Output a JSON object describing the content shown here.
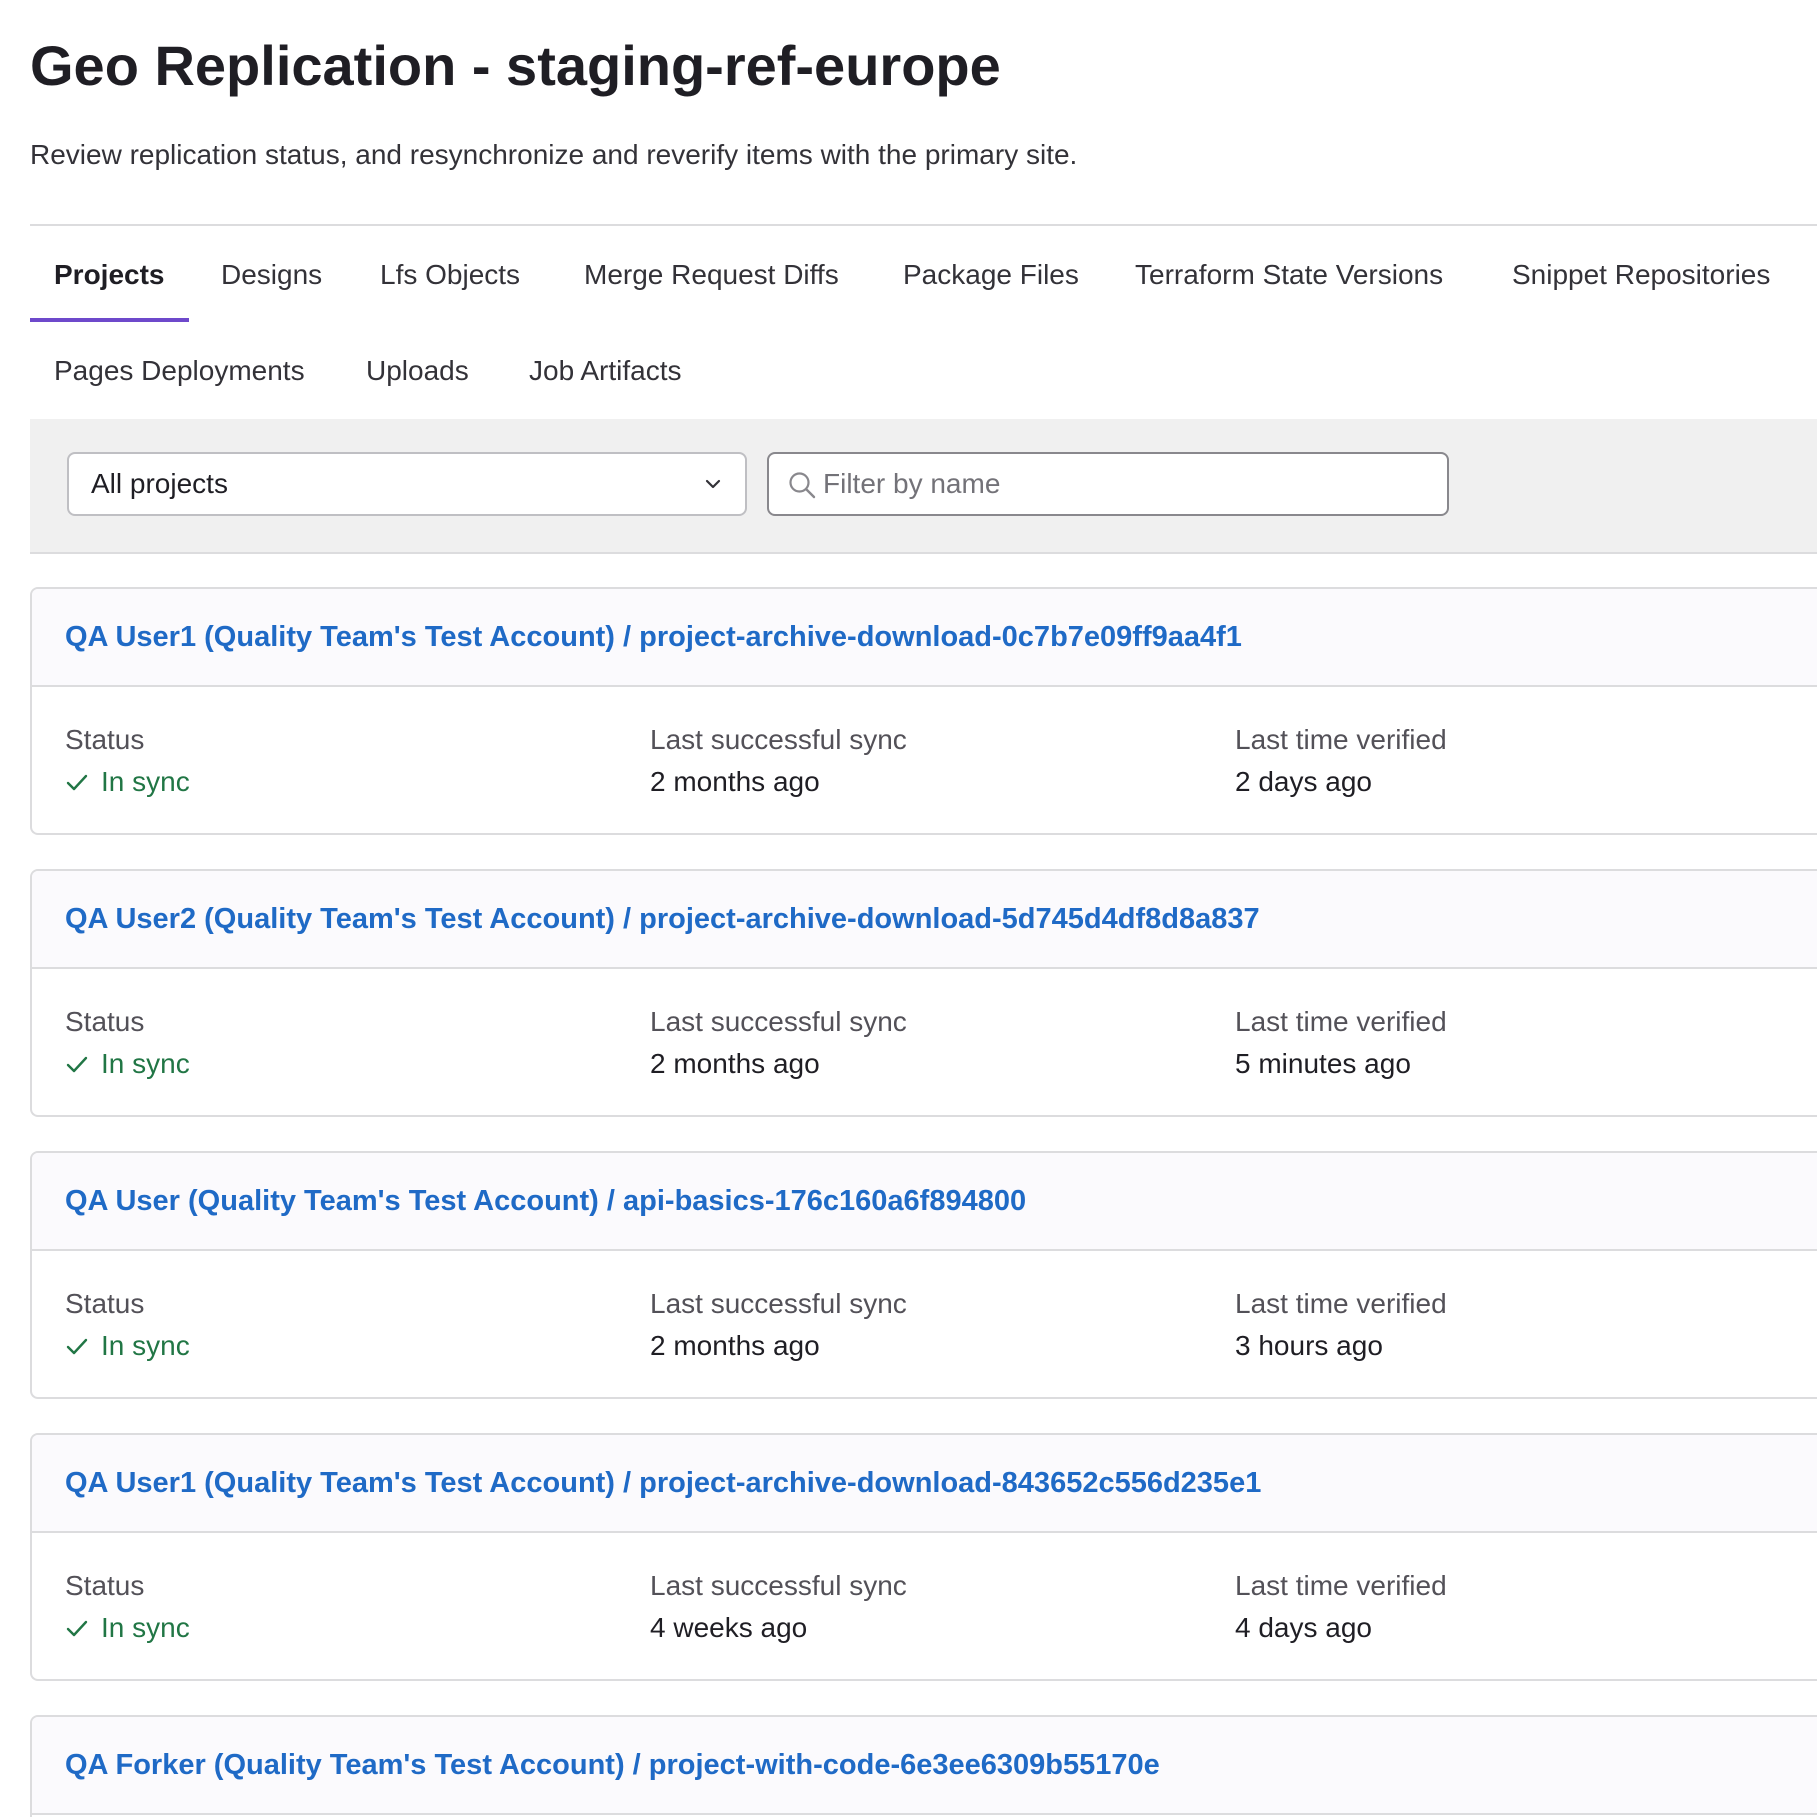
{
  "page": {
    "title": "Geo Replication - staging-ref-europe",
    "description": "Review replication status, and resynchronize and reverify items with the primary site."
  },
  "tabs": [
    {
      "label": "Projects",
      "active": true
    },
    {
      "label": "Designs",
      "active": false
    },
    {
      "label": "Lfs Objects",
      "active": false
    },
    {
      "label": "Merge Request Diffs",
      "active": false
    },
    {
      "label": "Package Files",
      "active": false
    },
    {
      "label": "Terraform State Versions",
      "active": false
    },
    {
      "label": "Snippet Repositories",
      "active": false
    },
    {
      "label": "Pages Deployments",
      "active": false
    },
    {
      "label": "Uploads",
      "active": false
    },
    {
      "label": "Job Artifacts",
      "active": false
    }
  ],
  "filters": {
    "scope_selected": "All projects",
    "search_placeholder": "Filter by name",
    "search_value": ""
  },
  "fields": {
    "status_label": "Status",
    "sync_label": "Last successful sync",
    "verified_label": "Last time verified"
  },
  "items": [
    {
      "name": "QA User1 (Quality Team's Test Account) / project-archive-download-0c7b7e09ff9aa4f1",
      "status": "In sync",
      "last_sync": "2 months ago",
      "last_verified": "2 days ago"
    },
    {
      "name": "QA User2 (Quality Team's Test Account) / project-archive-download-5d745d4df8d8a837",
      "status": "In sync",
      "last_sync": "2 months ago",
      "last_verified": "5 minutes ago"
    },
    {
      "name": "QA User (Quality Team's Test Account) / api-basics-176c160a6f894800",
      "status": "In sync",
      "last_sync": "2 months ago",
      "last_verified": "3 hours ago"
    },
    {
      "name": "QA User1 (Quality Team's Test Account) / project-archive-download-843652c556d235e1",
      "status": "In sync",
      "last_sync": "4 weeks ago",
      "last_verified": "4 days ago"
    },
    {
      "name": "QA Forker (Quality Team's Test Account) / project-with-code-6e3ee6309b55170e",
      "status": "",
      "last_sync": "",
      "last_verified": ""
    }
  ],
  "colors": {
    "link": "#1f6ac6",
    "success": "#217645",
    "active_tab_underline": "#6e49cb",
    "filter_bar_bg": "#f0f0f0"
  },
  "icons": {
    "status": "check-icon",
    "dropdown": "chevron-down-icon",
    "search": "search-icon"
  }
}
